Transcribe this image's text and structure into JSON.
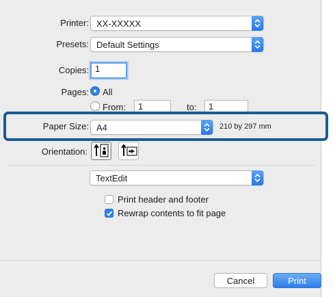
{
  "printer": {
    "label": "Printer:",
    "value": "XX-XXXXX"
  },
  "presets": {
    "label": "Presets:",
    "value": "Default Settings"
  },
  "copies": {
    "label": "Copies:",
    "value": "1"
  },
  "pages": {
    "label": "Pages:",
    "all_label": "All",
    "from_label": "From:",
    "from_value": "1",
    "to_label": "to:",
    "to_value": "1",
    "selected": "All"
  },
  "paper_size": {
    "label": "Paper Size:",
    "value": "A4",
    "dimensions": "210 by 297 mm"
  },
  "orientation": {
    "label": "Orientation:",
    "selected": "portrait"
  },
  "app_menu": {
    "value": "TextEdit"
  },
  "options": {
    "print_header_footer": {
      "label": "Print header and footer",
      "checked": false
    },
    "rewrap_contents": {
      "label": "Rewrap contents to fit page",
      "checked": true
    }
  },
  "buttons": {
    "cancel": "Cancel",
    "print": "Print"
  },
  "colors": {
    "accent": "#2f7fe6",
    "highlight_border": "#1c5b93",
    "dialog_bg": "#ececec"
  }
}
